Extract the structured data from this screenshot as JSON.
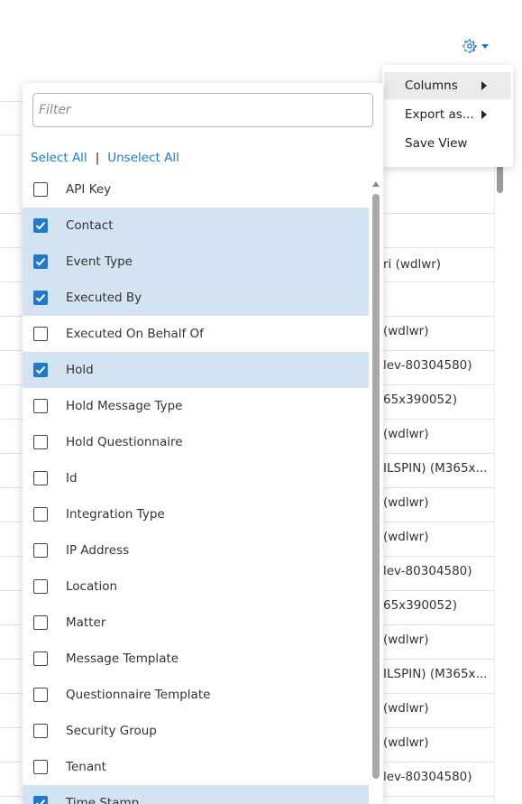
{
  "colors": {
    "accent": "#1f7acc",
    "checked_row_bg": "#d4e3f2",
    "menu_active_bg": "#ebebeb"
  },
  "toolbar": {
    "settings_icon": "gear-icon",
    "dropdown_icon": "caret-down-icon"
  },
  "background_table": {
    "cells": [
      "ri (wdlwr)",
      "(wdlwr)",
      "lev-80304580)",
      "65x390052)",
      "(wdlwr)",
      "ILSPIN) (M365x...",
      "(wdlwr)",
      "(wdlwr)",
      "lev-80304580)",
      "65x390052)",
      "(wdlwr)",
      "ILSPIN) (M365x...",
      "(wdlwr)",
      "(wdlwr)",
      "lev-80304580)"
    ]
  },
  "context_menu": {
    "items": [
      {
        "label": "Columns",
        "has_submenu": true,
        "active": true
      },
      {
        "label": "Export as...",
        "has_submenu": true,
        "active": false
      },
      {
        "label": "Save View",
        "has_submenu": false,
        "active": false
      }
    ]
  },
  "column_panel": {
    "filter_placeholder": "Filter",
    "filter_value": "",
    "select_all": "Select All",
    "separator": "|",
    "unselect_all": "Unselect All",
    "columns": [
      {
        "label": "API Key",
        "checked": false
      },
      {
        "label": "Contact",
        "checked": true
      },
      {
        "label": "Event Type",
        "checked": true
      },
      {
        "label": "Executed By",
        "checked": true
      },
      {
        "label": "Executed On Behalf Of",
        "checked": false
      },
      {
        "label": "Hold",
        "checked": true
      },
      {
        "label": "Hold Message Type",
        "checked": false
      },
      {
        "label": "Hold Questionnaire",
        "checked": false
      },
      {
        "label": "Id",
        "checked": false
      },
      {
        "label": "Integration Type",
        "checked": false
      },
      {
        "label": "IP Address",
        "checked": false
      },
      {
        "label": "Location",
        "checked": false
      },
      {
        "label": "Matter",
        "checked": false
      },
      {
        "label": "Message Template",
        "checked": false
      },
      {
        "label": "Questionnaire Template",
        "checked": false
      },
      {
        "label": "Security Group",
        "checked": false
      },
      {
        "label": "Tenant",
        "checked": false
      },
      {
        "label": "Time Stamp",
        "checked": true
      }
    ]
  }
}
